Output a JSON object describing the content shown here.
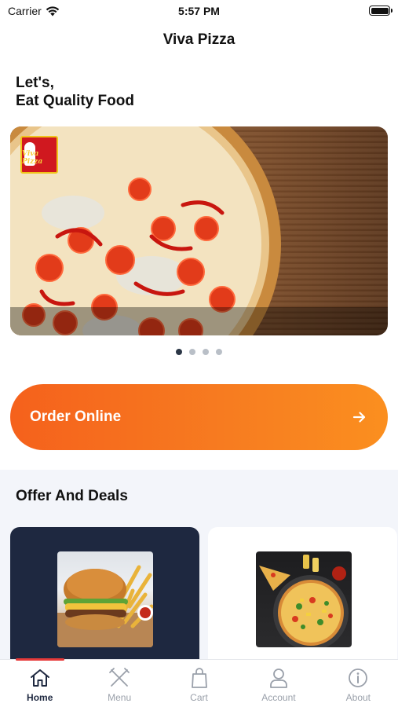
{
  "status_bar": {
    "carrier": "Carrier",
    "time": "5:57 PM"
  },
  "nav": {
    "title": "Viva Pizza"
  },
  "hero": {
    "greeting_line1": "Let's,",
    "greeting_line2": "Eat Quality Food",
    "banner_logo_text": "Viva Pizza",
    "carousel": {
      "page_count": 4,
      "active_index": 0
    }
  },
  "order_button": {
    "label": "Order Online",
    "icon": "arrow-right-icon"
  },
  "deals": {
    "title": "Offer And Deals",
    "cards": [
      {
        "image": "burger-fries",
        "theme": "dark"
      },
      {
        "image": "pizza-platter",
        "theme": "light"
      }
    ]
  },
  "tabs": [
    {
      "label": "Home",
      "icon": "home-icon",
      "active": true
    },
    {
      "label": "Menu",
      "icon": "fork-knife-icon",
      "active": false
    },
    {
      "label": "Cart",
      "icon": "bag-icon",
      "active": false
    },
    {
      "label": "Account",
      "icon": "user-icon",
      "active": false
    },
    {
      "label": "About",
      "icon": "info-icon",
      "active": false
    }
  ],
  "colors": {
    "accent_orange_start": "#f5611c",
    "accent_orange_end": "#fb8f1f",
    "navy": "#1e2840",
    "tab_indicator": "#e63a3a"
  }
}
